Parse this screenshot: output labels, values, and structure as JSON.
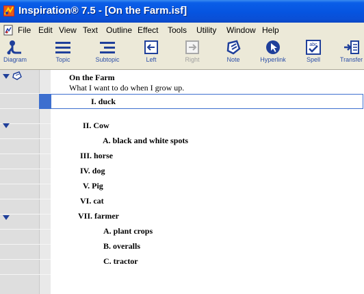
{
  "window": {
    "title": "Inspiration® 7.5 - [On the Farm.isf]"
  },
  "menu": {
    "items": [
      "File",
      "Edit",
      "View",
      "Text",
      "Outline",
      "Effect",
      "Tools",
      "Utility",
      "Window",
      "Help"
    ]
  },
  "toolbar": {
    "buttons": [
      {
        "label": "Diagram",
        "icon": "diagram-icon",
        "enabled": true
      },
      {
        "label": "Topic",
        "icon": "topic-icon",
        "enabled": true
      },
      {
        "label": "Subtopic",
        "icon": "subtopic-icon",
        "enabled": true
      },
      {
        "label": "Left",
        "icon": "left-arrow-icon",
        "enabled": true
      },
      {
        "label": "Right",
        "icon": "right-arrow-icon",
        "enabled": false
      },
      {
        "label": "Note",
        "icon": "note-icon",
        "enabled": true
      },
      {
        "label": "Hyperlink",
        "icon": "hyperlink-icon",
        "enabled": true
      },
      {
        "label": "Spell",
        "icon": "spell-icon",
        "enabled": true
      },
      {
        "label": "Transfer",
        "icon": "transfer-icon",
        "enabled": true
      }
    ]
  },
  "outline": {
    "main_idea": "On the Farm",
    "main_note": "What I want to do when I grow up.",
    "rows": [
      {
        "text": "I. duck",
        "expand": false,
        "selected": true
      },
      {
        "text": "II. Cow",
        "expand": true
      },
      {
        "text": "A. black and white spots"
      },
      {
        "text": "III. horse"
      },
      {
        "text": "IV. dog"
      },
      {
        "text": "V. Pig"
      },
      {
        "text": "VI. cat"
      },
      {
        "text": "VII. farmer",
        "expand": true
      },
      {
        "text": "A. plant crops"
      },
      {
        "text": "B. overalls"
      },
      {
        "text": "C. tractor"
      }
    ]
  },
  "colors": {
    "titlebar": "#0654e0",
    "selection": "#3d6fcf",
    "toolbar_label": "#2b4ea8"
  }
}
